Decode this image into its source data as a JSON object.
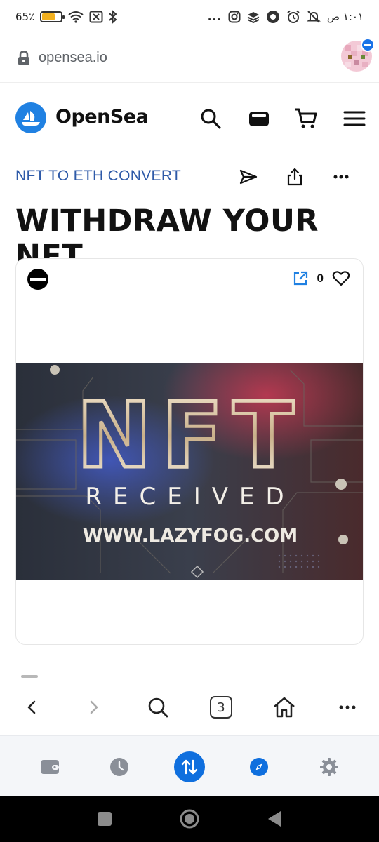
{
  "status_bar": {
    "battery_label": "65٪",
    "battery_level": 0.65,
    "clock": "١:٠١ ص",
    "more_dots": "..."
  },
  "browser": {
    "url": "opensea.io",
    "open_tabs": "3"
  },
  "site": {
    "brand_name": "OpenSea"
  },
  "page": {
    "collection_link": "NFT TO ETH CONVERT",
    "title": "WITHDRAW YOUR NFT"
  },
  "nft_card": {
    "favorite_count": "0",
    "image": {
      "headline": "NFT",
      "subline": "RECEIVED",
      "website": "WWW.LAZYFOG.COM"
    }
  },
  "colors": {
    "brand_blue": "#2081e2",
    "link_blue": "#2e5aa8",
    "wallet_active": "#0f6fde",
    "battery_fill": "#f2b01e"
  },
  "icons": {
    "status_left": [
      "battery-icon",
      "wifi-icon",
      "sim-off-icon",
      "bluetooth-icon"
    ],
    "status_right": [
      "more-dots-icon",
      "instagram-icon",
      "layers-icon",
      "record-icon",
      "alarm-icon",
      "mute-bell-icon"
    ],
    "header": [
      "opensea-logo-icon",
      "search-icon",
      "wallet-card-icon",
      "cart-icon",
      "menu-icon"
    ],
    "subheader": [
      "send-icon",
      "share-icon",
      "more-icon"
    ],
    "toolbar": [
      "back-icon",
      "forward-icon",
      "search-icon",
      "tabs-icon",
      "home-icon",
      "more-icon"
    ],
    "wallet_bar": [
      "wallet-icon",
      "history-icon",
      "swap-icon",
      "browser-compass-icon",
      "settings-icon"
    ]
  }
}
